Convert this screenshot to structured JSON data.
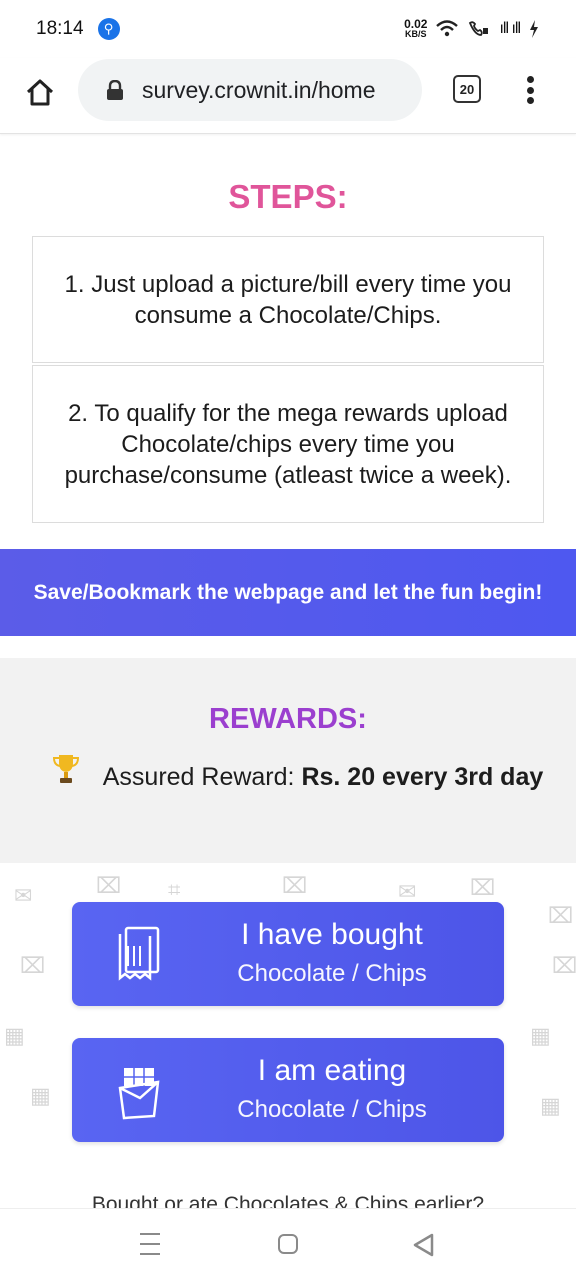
{
  "status_bar": {
    "time": "18:14",
    "usb_icon": "usb-icon",
    "net_speed_value": "0.02",
    "net_speed_unit": "KB/S",
    "signal_text": "ıll ıll"
  },
  "browser": {
    "url": "survey.crownit.in/home",
    "tab_count": "20"
  },
  "steps": {
    "title": "STEPS:",
    "items": [
      {
        "text": "1. Just upload a picture/bill every time you consume a Chocolate/Chips."
      },
      {
        "text": "2. To qualify for the mega rewards upload Chocolate/chips every time you purchase/consume (atleast twice a week)."
      }
    ]
  },
  "banner": {
    "text": "Save/Bookmark the webpage and let the fun begin!"
  },
  "rewards": {
    "title": "REWARDS:",
    "label": "Assured Reward: ",
    "value": "Rs. 20 every 3rd day"
  },
  "actions": {
    "bought": {
      "title": "I have bought",
      "subtitle": "Chocolate / Chips"
    },
    "eating": {
      "title": "I am eating",
      "subtitle": "Chocolate / Chips"
    },
    "earlier_text": "Bought or ate Chocolates & Chips earlier?"
  },
  "colors": {
    "steps_title": "#e0559a",
    "rewards_title": "#9b3fcf",
    "button_blue": "#5563ef"
  }
}
